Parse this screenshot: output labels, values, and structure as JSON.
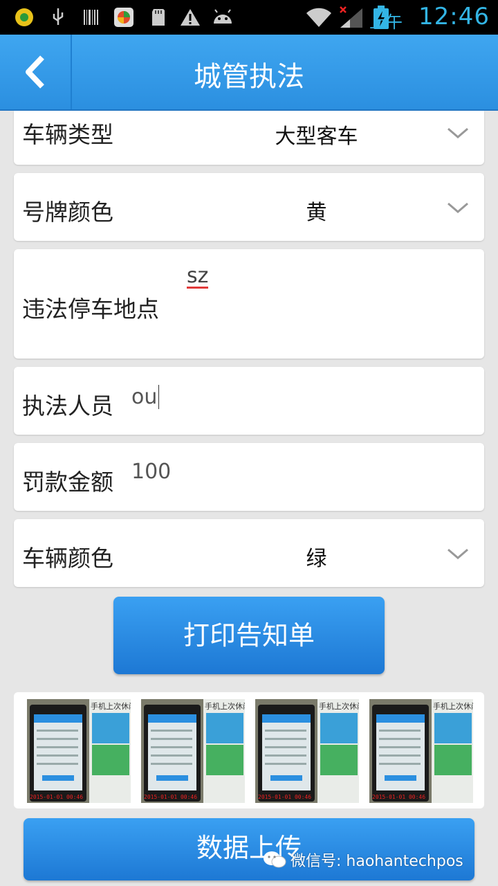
{
  "status_bar": {
    "ampm": "上午",
    "time": "12:46",
    "icons": [
      "app-icon",
      "usb-icon",
      "barcode-icon",
      "browser-icon",
      "sd-card-icon",
      "warning-icon",
      "android-icon",
      "wifi-icon",
      "signal-icon",
      "battery-charging-icon"
    ]
  },
  "header": {
    "title": "城管执法",
    "back_icon": "chevron-left-icon"
  },
  "form": {
    "vehicle_type": {
      "label": "车辆类型",
      "value": "大型客车"
    },
    "plate_color": {
      "label": "号牌颜色",
      "value": "黄"
    },
    "location": {
      "label": "违法停车地点",
      "value": "sz"
    },
    "officer": {
      "label": "执法人员",
      "value": "ou"
    },
    "fine": {
      "label": "罚款金额",
      "value": "100"
    },
    "vehicle_color": {
      "label": "车辆颜色",
      "value": "绿"
    }
  },
  "buttons": {
    "print": "打印告知单",
    "upload": "数据上传"
  },
  "photos": [
    {
      "caption": "手机上次休闲",
      "timestamp": "2015-01-01 00:46"
    },
    {
      "caption": "手机上次休闲",
      "timestamp": "2015-01-01 00:46"
    },
    {
      "caption": "手机上次休闲",
      "timestamp": "2015-01-01 00:46"
    },
    {
      "caption": "手机上次休闲",
      "timestamp": "2015-01-01 00:46"
    }
  ],
  "watermark": "微信号: haohantechpos",
  "colors": {
    "accent": "#2b8fe0",
    "status_text": "#33b5e5",
    "underline": "#e23a3a"
  }
}
